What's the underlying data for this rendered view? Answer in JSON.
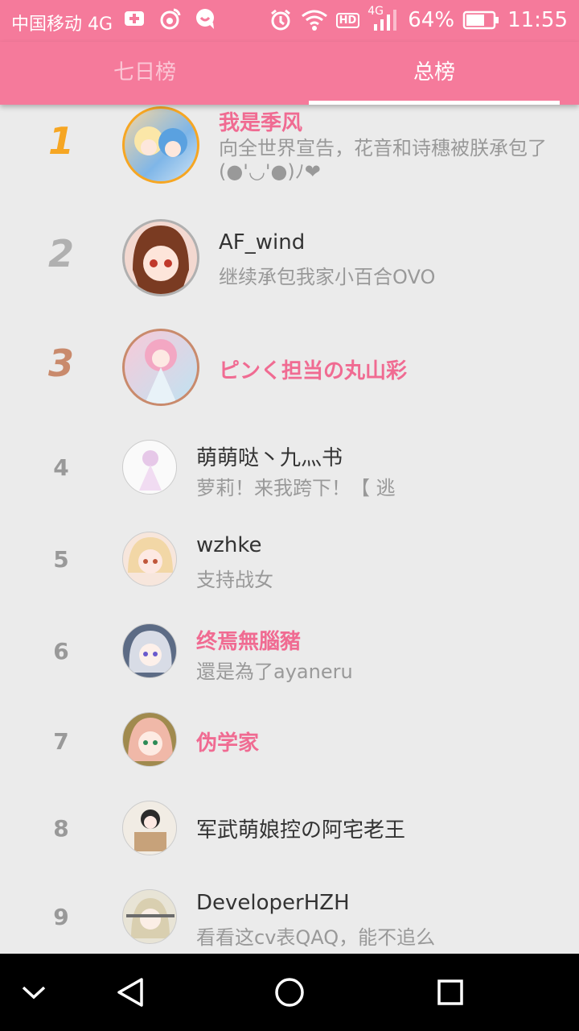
{
  "status_bar": {
    "carrier": "中国移动 4G",
    "network_badge": "4G",
    "hd_badge": "HD",
    "battery": "64%",
    "time": "11:55"
  },
  "tabs": [
    {
      "label": "七日榜",
      "selected": false
    },
    {
      "label": "总榜",
      "selected": true
    }
  ],
  "colors": {
    "accent": "#f57a9b",
    "pink_text": "#f06b92",
    "gold": "#f6a623",
    "silver": "#b0b0b0",
    "bronze": "#c98a6c"
  },
  "ranking": [
    {
      "rank": "1",
      "name": "我是季风",
      "message": "向全世界宣告，花音和诗穗被朕承包了(●'◡'●)ﾉ❤",
      "highlight": true
    },
    {
      "rank": "2",
      "name": "AF_wind",
      "message": "继续承包我家小百合OVO",
      "highlight": false
    },
    {
      "rank": "3",
      "name": "ピンく担当の丸山彩",
      "message": "",
      "highlight": true
    },
    {
      "rank": "4",
      "name": "萌萌哒丶九灬书",
      "message": "萝莉！来我跨下！【 逃",
      "highlight": false
    },
    {
      "rank": "5",
      "name": "wzhke",
      "message": "支持战女",
      "highlight": false
    },
    {
      "rank": "6",
      "name": "终焉無腦豬",
      "message": "還是為了ayaneru",
      "highlight": true
    },
    {
      "rank": "7",
      "name": "伪学家",
      "message": "",
      "highlight": true
    },
    {
      "rank": "8",
      "name": "军武萌娘控の阿宅老王",
      "message": "",
      "highlight": false
    },
    {
      "rank": "9",
      "name": "DeveloperHZH",
      "message": "看看这cv表QAQ，能不追么",
      "highlight": false
    }
  ],
  "nav_icons": [
    "chevron-down-icon",
    "back-triangle-icon",
    "home-circle-icon",
    "recents-square-icon"
  ]
}
